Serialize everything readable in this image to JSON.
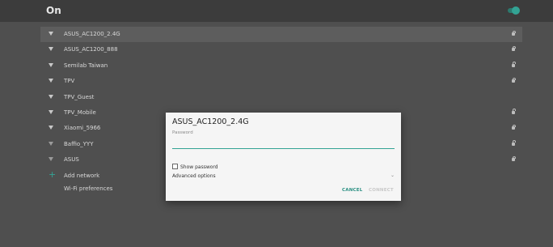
{
  "header": {
    "label": "On",
    "toggle_state": "on",
    "accent": "#33a394"
  },
  "networks": [
    {
      "name": "ASUS_AC1200_2.4G",
      "secured": true,
      "selected": true
    },
    {
      "name": "ASUS_AC1200_888",
      "secured": true
    },
    {
      "name": "Semilab Taiwan",
      "secured": true
    },
    {
      "name": "TPV",
      "secured": true
    },
    {
      "name": "TPV_Guest",
      "secured": false
    },
    {
      "name": "TPV_Mobile",
      "secured": true
    },
    {
      "name": "Xiaomi_5966",
      "secured": true
    },
    {
      "name": "Baffio_YYY",
      "secured": true
    },
    {
      "name": "ASUS",
      "secured": true
    }
  ],
  "add_network": {
    "label": "Add network",
    "icon": "plus-icon"
  },
  "wifi_preferences": {
    "label": "Wi-Fi preferences"
  },
  "dialog": {
    "title": "ASUS_AC1200_2.4G",
    "password_label": "Password",
    "password_value": "",
    "show_password_label": "Show password",
    "show_password_checked": false,
    "advanced_options_label": "Advanced options",
    "cancel_label": "CANCEL",
    "connect_label": "CONNECT"
  }
}
